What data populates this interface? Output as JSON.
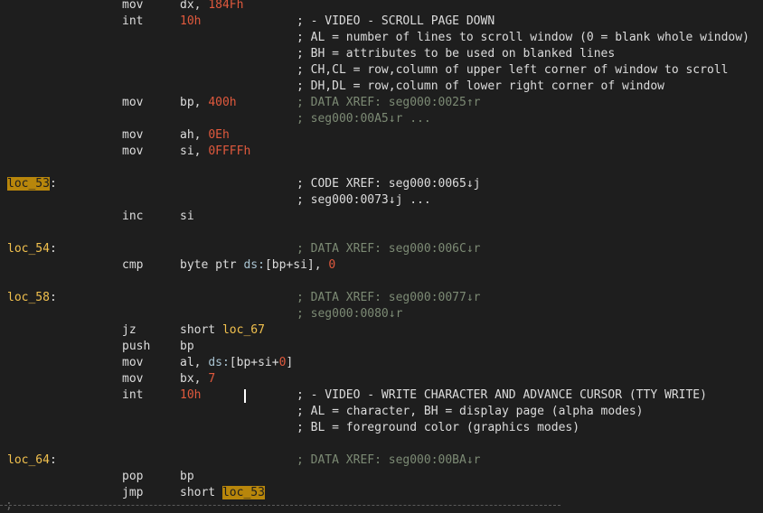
{
  "lines": [
    {
      "mnemonic": "mov",
      "ops": [
        {
          "t": "dx, ",
          "c": "plain"
        },
        {
          "t": "184Fh",
          "c": "num"
        }
      ]
    },
    {
      "mnemonic": "int",
      "ops": [
        {
          "t": "10h",
          "c": "num"
        }
      ],
      "comment": "; - VIDEO - SCROLL PAGE DOWN",
      "comment_class": "main"
    },
    {
      "comment": "; AL = number of lines to scroll window (0 = blank whole window)",
      "comment_class": "main"
    },
    {
      "comment": "; BH = attributes to be used on blanked lines",
      "comment_class": "main"
    },
    {
      "comment": "; CH,CL = row,column of upper left corner of window to scroll",
      "comment_class": "main"
    },
    {
      "comment": "; DH,DL = row,column of lower right corner of window",
      "comment_class": "main"
    },
    {
      "mnemonic": "mov",
      "ops": [
        {
          "t": "bp, ",
          "c": "plain"
        },
        {
          "t": "400h",
          "c": "num"
        }
      ],
      "comment": "; DATA XREF: seg000:0025↑r",
      "comment_class": "xref"
    },
    {
      "comment": "; seg000:00A5↓r ...",
      "comment_class": "xref"
    },
    {
      "mnemonic": "mov",
      "ops": [
        {
          "t": "ah, ",
          "c": "plain"
        },
        {
          "t": "0Eh",
          "c": "num"
        }
      ]
    },
    {
      "mnemonic": "mov",
      "ops": [
        {
          "t": "si, ",
          "c": "plain"
        },
        {
          "t": "0FFFFh",
          "c": "num"
        }
      ]
    },
    {},
    {
      "label": "loc_53",
      "label_highlight": true,
      "comment": "; CODE XREF: seg000:0065↓j",
      "comment_class": "main"
    },
    {
      "comment": "; seg000:0073↓j ...",
      "comment_class": "main"
    },
    {
      "mnemonic": "inc",
      "ops": [
        {
          "t": "si",
          "c": "plain"
        }
      ]
    },
    {},
    {
      "label": "loc_54",
      "comment": "; DATA XREF: seg000:006C↓r",
      "comment_class": "xref"
    },
    {
      "mnemonic": "cmp",
      "ops": [
        {
          "t": "byte ptr ",
          "c": "plain"
        },
        {
          "t": "ds:",
          "c": "seg"
        },
        {
          "t": "[bp+si], ",
          "c": "plain"
        },
        {
          "t": "0",
          "c": "num"
        }
      ]
    },
    {},
    {
      "label": "loc_58",
      "comment": "; DATA XREF: seg000:0077↓r",
      "comment_class": "xref"
    },
    {
      "comment": "; seg000:0080↓r",
      "comment_class": "xref"
    },
    {
      "mnemonic": "jz",
      "ops": [
        {
          "t": "short ",
          "c": "plain"
        },
        {
          "t": "loc_67",
          "c": "locref"
        }
      ]
    },
    {
      "mnemonic": "push",
      "ops": [
        {
          "t": "bp",
          "c": "plain"
        }
      ]
    },
    {
      "mnemonic": "mov",
      "ops": [
        {
          "t": "al, ",
          "c": "plain"
        },
        {
          "t": "ds:",
          "c": "seg"
        },
        {
          "t": "[bp+si+",
          "c": "plain"
        },
        {
          "t": "0",
          "c": "num"
        },
        {
          "t": "]",
          "c": "plain"
        }
      ]
    },
    {
      "mnemonic": "mov",
      "ops": [
        {
          "t": "bx, ",
          "c": "plain"
        },
        {
          "t": "7",
          "c": "num"
        }
      ]
    },
    {
      "mnemonic": "int",
      "ops": [
        {
          "t": "10h",
          "c": "num"
        }
      ],
      "cursor": true,
      "comment": "; - VIDEO - WRITE CHARACTER AND ADVANCE CURSOR (TTY WRITE)",
      "comment_class": "main"
    },
    {
      "comment": "; AL = character, BH = display page (alpha modes)",
      "comment_class": "main"
    },
    {
      "comment": "; BL = foreground color (graphics modes)",
      "comment_class": "main"
    },
    {},
    {
      "label": "loc_64",
      "comment": "; DATA XREF: seg000:00BA↓r",
      "comment_class": "xref"
    },
    {
      "mnemonic": "pop",
      "ops": [
        {
          "t": "bp",
          "c": "plain"
        }
      ]
    },
    {
      "mnemonic": "jmp",
      "ops": [
        {
          "t": "short ",
          "c": "plain"
        },
        {
          "t": "loc_53",
          "c": "hl-locref"
        }
      ]
    }
  ],
  "separator_char": ";"
}
